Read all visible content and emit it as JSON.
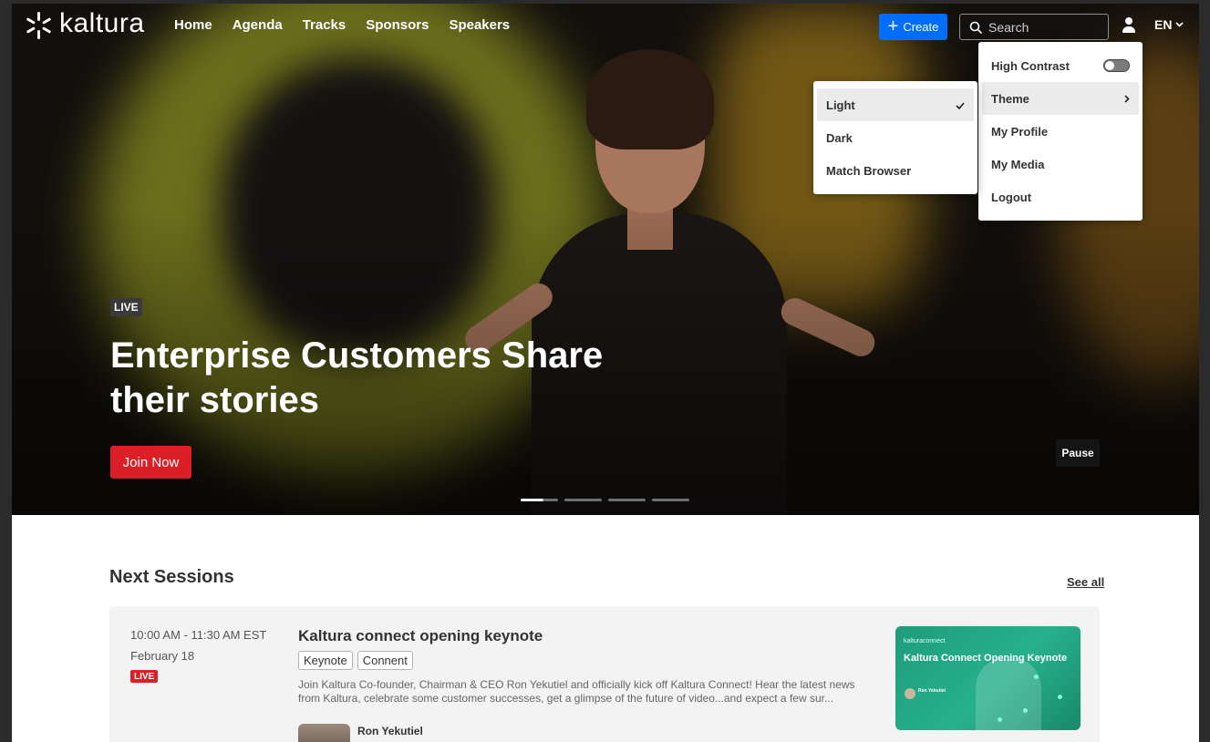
{
  "brand": {
    "name": "kaltura"
  },
  "nav": {
    "links": [
      "Home",
      "Agenda",
      "Tracks",
      "Sponsors",
      "Speakers"
    ]
  },
  "header": {
    "create_label": "Create",
    "search_placeholder": "Search",
    "lang": "EN"
  },
  "user_menu": {
    "items": [
      {
        "label": "High Contrast",
        "type": "toggle",
        "on": false
      },
      {
        "label": "Theme",
        "type": "submenu",
        "selected": true
      },
      {
        "label": "My Profile"
      },
      {
        "label": "My Media"
      },
      {
        "label": "Logout"
      }
    ]
  },
  "theme_menu": {
    "items": [
      {
        "label": "Light",
        "checked": true
      },
      {
        "label": "Dark"
      },
      {
        "label": "Match Browser"
      }
    ]
  },
  "hero": {
    "badge": "LIVE",
    "title": "Enterprise Customers Share their stories",
    "join_label": "Join Now",
    "pause_label": "Pause",
    "slides": 4,
    "active_slide": 1
  },
  "sessions": {
    "title": "Next Sessions",
    "see_all": "See all",
    "items": [
      {
        "time": "10:00 AM - 11:30 AM EST",
        "date": "February 18",
        "badge": "LIVE",
        "title": "Kaltura connect opening keynote",
        "tags": [
          "Keynote",
          "Connent"
        ],
        "description": "Join Kaltura Co-founder, Chairman & CEO Ron Yekutiel and officially kick off Kaltura Connect! Hear the latest news from Kaltura, celebrate some customer successes, get a glimpse of the future of video...and expect a few sur...",
        "speaker": "Ron Yekutiel",
        "thumb": {
          "brand": "kalturaconnect",
          "title": "Kaltura Connect Opening Keynote",
          "speaker": "Ron Yekutiel"
        }
      }
    ]
  },
  "colors": {
    "create": "#006efa",
    "join": "#da1f26",
    "live_red": "#da1f26",
    "thumb_green": "#27b08c"
  }
}
